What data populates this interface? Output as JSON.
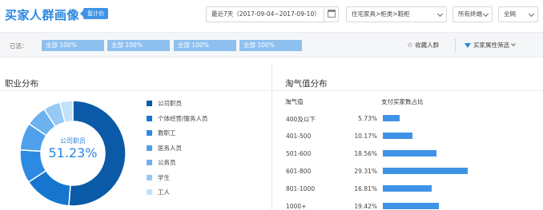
{
  "header": {
    "title": "买家人群画像",
    "badge": "复计价",
    "date_range": "最近7天（2017-09-04~2017-09-10）",
    "category": "住宅家具>柜类>鞋柜",
    "terminal": "所有终端",
    "network": "全网"
  },
  "filters": {
    "label": "已选：",
    "chips": [
      "全部 100%",
      "全部 100%",
      "全部 100%",
      "全部 100%"
    ],
    "favorite_label": "收藏人群",
    "attribute_filter_label": "买家属性筛选"
  },
  "occupation": {
    "title": "职业分布",
    "center_label": "公司职员",
    "center_value": "51.23%",
    "slices": [
      {
        "label": "公司职员",
        "value": 51.23,
        "color": "#0a5aa7"
      },
      {
        "label": "个体经营/服务人员",
        "value": 14.6,
        "color": "#1676cf"
      },
      {
        "label": "教职工",
        "value": 10.2,
        "color": "#2c8ae3"
      },
      {
        "label": "医务人员",
        "value": 8.4,
        "color": "#4fa0ea"
      },
      {
        "label": "公务员",
        "value": 6.4,
        "color": "#6cb2ef"
      },
      {
        "label": "学生",
        "value": 5.2,
        "color": "#96c9f4"
      },
      {
        "label": "工人",
        "value": 3.97,
        "color": "#c2e1fa"
      }
    ]
  },
  "taoqi": {
    "title": "淘气值分布",
    "col_range": "淘气值",
    "col_pct": "支付买家数占比",
    "rows": [
      {
        "range": "400及以下",
        "pct_text": "5.73%",
        "value": 5.73
      },
      {
        "range": "401-500",
        "pct_text": "10.17%",
        "value": 10.17
      },
      {
        "range": "501-600",
        "pct_text": "18.56%",
        "value": 18.56
      },
      {
        "range": "601-800",
        "pct_text": "29.31%",
        "value": 29.31
      },
      {
        "range": "801-1000",
        "pct_text": "16.81%",
        "value": 16.81
      },
      {
        "range": "1000+",
        "pct_text": "19.42%",
        "value": 19.42
      }
    ]
  }
}
